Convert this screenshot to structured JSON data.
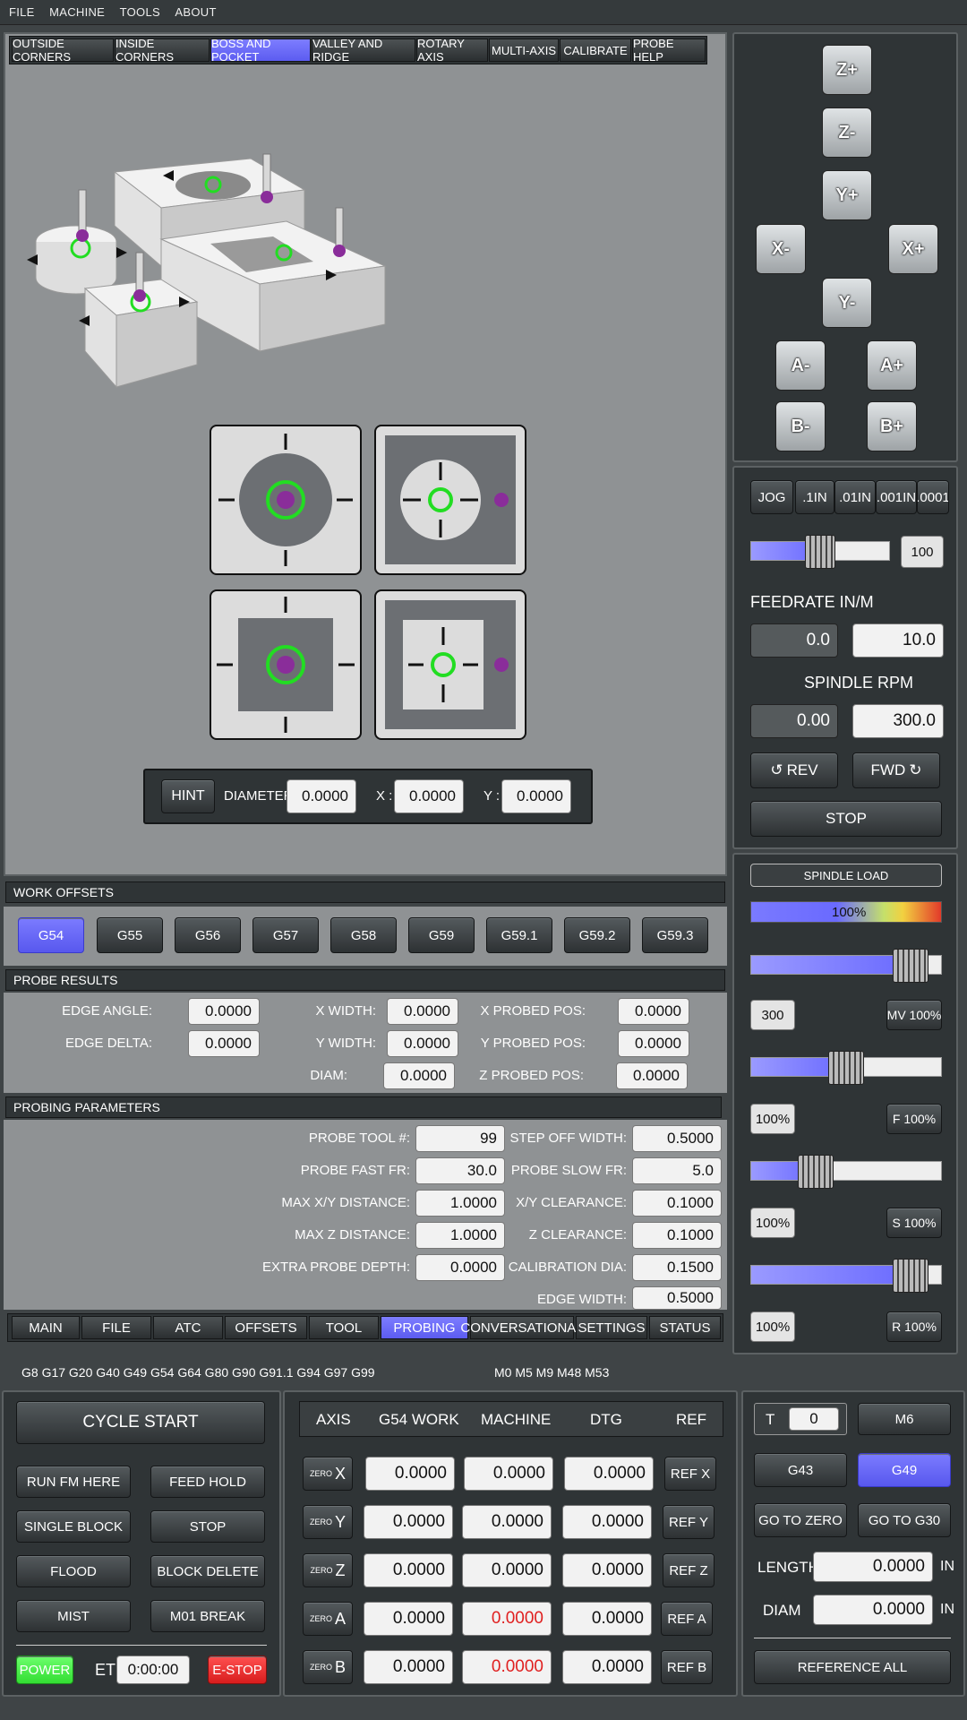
{
  "menu": [
    "FILE",
    "MACHINE",
    "TOOLS",
    "ABOUT"
  ],
  "probe_tabs": [
    "OUTSIDE CORNERS",
    "INSIDE CORNERS",
    "BOSS AND POCKET",
    "VALLEY AND RIDGE",
    "ROTARY AXIS",
    "MULTI-AXIS",
    "CALIBRATE",
    "PROBE HELP"
  ],
  "hint": {
    "label": "HINT",
    "diameter_label": "DIAMETER:",
    "diameter": "0.0000",
    "x_label": "X :",
    "x": "0.0000",
    "y_label": "Y :",
    "y": "0.0000"
  },
  "work_offsets": {
    "title": "WORK OFFSETS",
    "items": [
      "G54",
      "G55",
      "G56",
      "G57",
      "G58",
      "G59",
      "G59.1",
      "G59.2",
      "G59.3"
    ]
  },
  "probe_results": {
    "title": "PROBE RESULTS",
    "edge_angle_label": "EDGE ANGLE:",
    "edge_angle": "0.0000",
    "edge_delta_label": "EDGE DELTA:",
    "edge_delta": "0.0000",
    "x_width_label": "X WIDTH:",
    "x_width": "0.0000",
    "y_width_label": "Y WIDTH:",
    "y_width": "0.0000",
    "diam_label": "DIAM:",
    "diam": "0.0000",
    "x_probed_label": "X PROBED POS:",
    "x_probed": "0.0000",
    "y_probed_label": "Y PROBED POS:",
    "y_probed": "0.0000",
    "z_probed_label": "Z PROBED POS:",
    "z_probed": "0.0000"
  },
  "probing_params": {
    "title": "PROBING PARAMETERS",
    "probe_tool_label": "PROBE TOOL #:",
    "probe_tool": "99",
    "fast_fr_label": "PROBE FAST FR:",
    "fast_fr": "30.0",
    "max_xy_label": "MAX X/Y DISTANCE:",
    "max_xy": "1.0000",
    "max_z_label": "MAX Z DISTANCE:",
    "max_z": "1.0000",
    "extra_depth_label": "EXTRA PROBE DEPTH:",
    "extra_depth": "0.0000",
    "step_off_label": "STEP OFF WIDTH:",
    "step_off": "0.5000",
    "slow_fr_label": "PROBE SLOW FR:",
    "slow_fr": "5.0",
    "xy_clear_label": "X/Y CLEARANCE:",
    "xy_clear": "0.1000",
    "z_clear_label": "Z CLEARANCE:",
    "z_clear": "0.1000",
    "cal_dia_label": "CALIBRATION DIA:",
    "cal_dia": "0.1500",
    "edge_width_label": "EDGE WIDTH:",
    "edge_width": "0.5000"
  },
  "main_tabs": [
    "MAIN",
    "FILE",
    "ATC",
    "OFFSETS",
    "TOOL",
    "PROBING",
    "CONVERSATIONAL",
    "SETTINGS",
    "STATUS"
  ],
  "gcodes": "G8 G17 G20 G40 G49 G54 G64 G80 G90 G91.1 G94 G97 G99",
  "mcodes": "M0 M5 M9 M48 M53",
  "jog": {
    "zplus": "Z+",
    "zminus": "Z-",
    "yplus": "Y+",
    "yminus": "Y-",
    "xminus": "X-",
    "xplus": "X+",
    "aminus": "A-",
    "aplus": "A+",
    "bminus": "B-",
    "bplus": "B+"
  },
  "jog_steps": [
    "JOG",
    ".1IN",
    ".01IN",
    ".001IN",
    ".0001"
  ],
  "jog_rate": {
    "value": "100",
    "level": 0.5
  },
  "feed": {
    "title": "FEEDRATE IN/M",
    "actual": "0.0",
    "set": "10.0"
  },
  "spindle": {
    "title": "SPINDLE RPM",
    "actual": "0.00",
    "set": "300.0",
    "rev": "REV",
    "fwd": "FWD",
    "stop": "STOP"
  },
  "spindle_load": {
    "title": "SPINDLE LOAD",
    "percent": "100%"
  },
  "overrides": [
    {
      "value": "300",
      "button": "MV 100%",
      "level": 0.92
    },
    {
      "value": "100%",
      "button": "F 100%",
      "level": 0.5
    },
    {
      "value": "100%",
      "button": "S 100%",
      "level": 0.3
    },
    {
      "value": "100%",
      "button": "R 100%",
      "level": 0.92
    }
  ],
  "control": {
    "cycle_start": "CYCLE START",
    "run_fm_here": "RUN FM HERE",
    "feed_hold": "FEED HOLD",
    "single_block": "SINGLE BLOCK",
    "stop": "STOP",
    "flood": "FLOOD",
    "block_delete": "BLOCK DELETE",
    "mist": "MIST",
    "m01_break": "M01 BREAK",
    "power": "POWER",
    "et_label": "ET",
    "et": "0:00:00",
    "estop": "E-STOP"
  },
  "dro": {
    "headers": [
      "AXIS",
      "G54 WORK",
      "MACHINE",
      "DTG",
      "REF"
    ],
    "zero_label": "ZERO",
    "rows": [
      {
        "axis": "X",
        "work": "0.0000",
        "machine": "0.0000",
        "dtg": "0.0000",
        "ref": "REF X"
      },
      {
        "axis": "Y",
        "work": "0.0000",
        "machine": "0.0000",
        "dtg": "0.0000",
        "ref": "REF Y"
      },
      {
        "axis": "Z",
        "work": "0.0000",
        "machine": "0.0000",
        "dtg": "0.0000",
        "ref": "REF Z"
      },
      {
        "axis": "A",
        "work": "0.0000",
        "machine": "0.0000",
        "dtg": "0.0000",
        "ref": "REF A"
      },
      {
        "axis": "B",
        "work": "0.0000",
        "machine": "0.0000",
        "dtg": "0.0000",
        "ref": "REF B"
      }
    ]
  },
  "tool": {
    "t_label": "T",
    "t": "0",
    "m6": "M6",
    "g43": "G43",
    "g49": "G49",
    "go_zero": "GO TO ZERO",
    "go_g30": "GO TO G30",
    "length_label": "LENGTH",
    "length": "0.0000",
    "length_unit": "IN",
    "diam_label": "DIAM",
    "diam": "0.0000",
    "diam_unit": "IN",
    "reference_all": "REFERENCE ALL"
  },
  "colors": {
    "accent": "#6a6aff",
    "probe_green": "#22dd22",
    "probe_ball": "#8a2d9a",
    "error_red": "#e02020"
  }
}
